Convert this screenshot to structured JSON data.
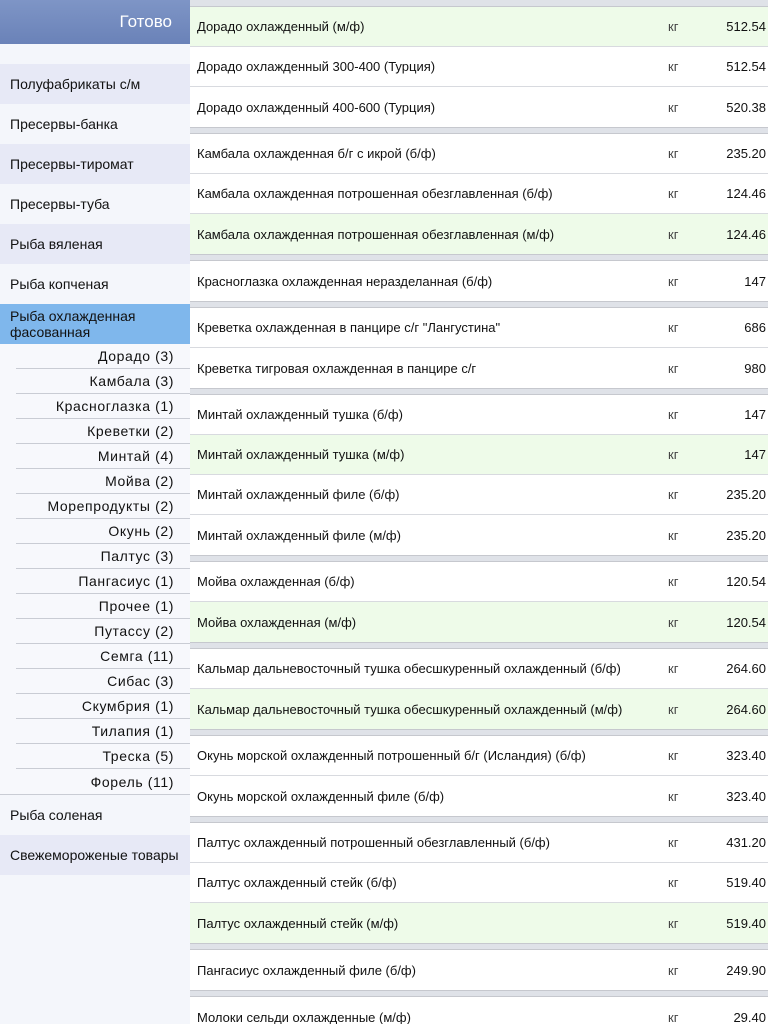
{
  "done_label": "Готово",
  "categories_top": [
    "Полуфабрикаты с/м",
    "Пресервы-банка",
    "Пресервы-тиромат",
    "Пресервы-туба",
    "Рыба вяленая",
    "Рыба копченая"
  ],
  "selected_category": "Рыба охлажденная фасованная",
  "subcategories": [
    "Дорадо (3)",
    "Камбала (3)",
    "Красноглазка (1)",
    "Креветки (2)",
    "Минтай (4)",
    "Мойва (2)",
    "Морепродукты (2)",
    "Окунь (2)",
    "Палтус (3)",
    "Пангасиус (1)",
    "Прочее (1)",
    "Путассу (2)",
    "Семга (11)",
    "Сибас (3)",
    "Скумбрия (1)",
    "Тилапия (1)",
    "Треска (5)",
    "Форель (11)"
  ],
  "categories_bottom": [
    "Рыба соленая",
    "Свежемороженые товары"
  ],
  "products": [
    {
      "name": "Дорадо охлажденный (м/ф)",
      "unit": "кг",
      "price": "512.54"
    },
    {
      "name": "Дорадо охлажденный 300-400 (Турция)",
      "unit": "кг",
      "price": "512.54"
    },
    {
      "name": "Дорадо охлажденный 400-600 (Турция)",
      "unit": "кг",
      "price": "520.38"
    },
    {
      "name": "Камбала охлажденная б/г с икрой (б/ф)",
      "unit": "кг",
      "price": "235.20"
    },
    {
      "name": "Камбала охлажденная потрошенная обезглавленная (б/ф)",
      "unit": "кг",
      "price": "124.46"
    },
    {
      "name": "Камбала охлажденная потрошенная обезглавленная (м/ф)",
      "unit": "кг",
      "price": "124.46"
    },
    {
      "name": "Красноглазка охлажденная неразделанная (б/ф)",
      "unit": "кг",
      "price": "147"
    },
    {
      "name": "Креветка охлажденная в панцире с/г \"Лангустина\"",
      "unit": "кг",
      "price": "686"
    },
    {
      "name": "Креветка тигровая охлажденная в панцире с/г",
      "unit": "кг",
      "price": "980"
    },
    {
      "name": "Минтай охлажденный тушка (б/ф)",
      "unit": "кг",
      "price": "147"
    },
    {
      "name": "Минтай охлажденный тушка (м/ф)",
      "unit": "кг",
      "price": "147"
    },
    {
      "name": "Минтай охлажденный филе (б/ф)",
      "unit": "кг",
      "price": "235.20"
    },
    {
      "name": "Минтай охлажденный филе (м/ф)",
      "unit": "кг",
      "price": "235.20"
    },
    {
      "name": "Мойва охлажденная (б/ф)",
      "unit": "кг",
      "price": "120.54"
    },
    {
      "name": "Мойва охлажденная (м/ф)",
      "unit": "кг",
      "price": "120.54"
    },
    {
      "name": "Кальмар дальневосточный тушка обесшкуренный охлажденный (б/ф)",
      "unit": "кг",
      "price": "264.60"
    },
    {
      "name": "Кальмар дальневосточный тушка обесшкуренный охлажденный (м/ф)",
      "unit": "кг",
      "price": "264.60"
    },
    {
      "name": "Окунь морской охлажденный потрошенный б/г (Исландия) (б/ф)",
      "unit": "кг",
      "price": "323.40"
    },
    {
      "name": "Окунь морской охлажденный филе (б/ф)",
      "unit": "кг",
      "price": "323.40"
    },
    {
      "name": "Палтус охлажденный потрошенный обезглавленный (б/ф)",
      "unit": "кг",
      "price": "431.20"
    },
    {
      "name": "Палтус охлажденный стейк (б/ф)",
      "unit": "кг",
      "price": "519.40"
    },
    {
      "name": "Палтус охлажденный стейк (м/ф)",
      "unit": "кг",
      "price": "519.40"
    },
    {
      "name": "Пангасиус охлажденный филе (б/ф)",
      "unit": "кг",
      "price": "249.90"
    },
    {
      "name": "Молоки сельди охлажденные (м/ф)",
      "unit": "кг",
      "price": "29.40"
    }
  ]
}
